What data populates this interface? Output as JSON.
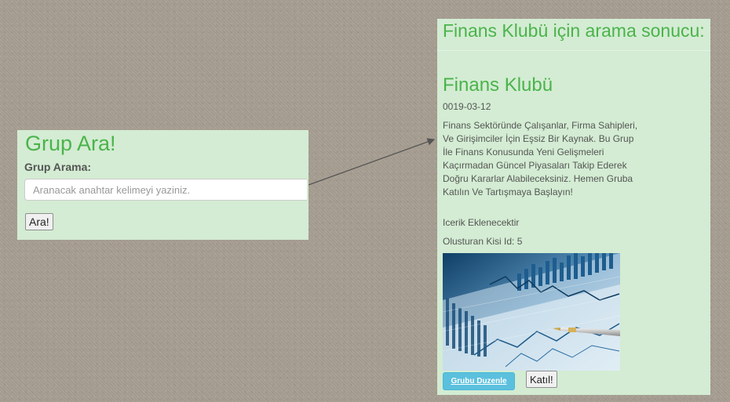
{
  "search": {
    "title": "Grup Ara!",
    "label": "Grup Arama:",
    "placeholder": "Aranacak anahtar kelimeyi yaziniz.",
    "value": "",
    "button": "Ara!"
  },
  "result": {
    "heading": "Finans Klubü için arama sonucu:",
    "group": {
      "name": "Finans Klubü",
      "date": "0019-03-12",
      "description": "Finans Sektöründe Çalışanlar, Firma Sahipleri, Ve Girişimciler İçin Eşsiz Bir Kaynak. Bu Grup İle Finans Konusunda Yeni Gelişmeleri Kaçırmadan Güncel Piyasaları Takip Ederek Doğru Kararlar Alabileceksiniz. Hemen Gruba Katılın Ve Tartışmaya Başlayın!",
      "content_note": "Icerik Eklenecektir",
      "creator": "Olusturan Kisi Id: 5",
      "edit_button": "Grubu Duzenle",
      "join_button": "Katıl!"
    }
  },
  "colors": {
    "panel_bg": "#d3ecd3",
    "heading_green": "#4bb34b",
    "edit_button": "#5bc0de",
    "page_bg": "#a89f93"
  }
}
